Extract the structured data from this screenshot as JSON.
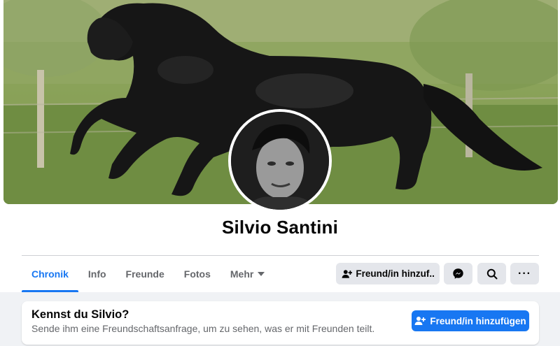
{
  "profile": {
    "name": "Silvio Santini",
    "cover_icon": "horse-photo",
    "avatar_icon": "profile-photo"
  },
  "tabs": [
    {
      "label": "Chronik",
      "active": true
    },
    {
      "label": "Info",
      "active": false
    },
    {
      "label": "Freunde",
      "active": false
    },
    {
      "label": "Fotos",
      "active": false
    },
    {
      "label": "Mehr",
      "active": false
    }
  ],
  "actions": {
    "add_friend_label": "Freund/in hinzuf...",
    "add_friend_icon": "add-friend-icon",
    "message_icon": "messenger-icon",
    "search_icon": "search-icon",
    "more_label": "···"
  },
  "suggestion": {
    "title": "Kennst du Silvio?",
    "subtitle": "Sende ihm eine Freundschaftsanfrage, um zu sehen, was er mit Freunden teilt.",
    "button_label": "Freund/in hinzufügen"
  },
  "colors": {
    "accent": "#1877f2",
    "page_bg": "#f0f2f5",
    "button_bg": "#e4e6eb",
    "text_primary": "#050505",
    "text_secondary": "#65676b"
  }
}
